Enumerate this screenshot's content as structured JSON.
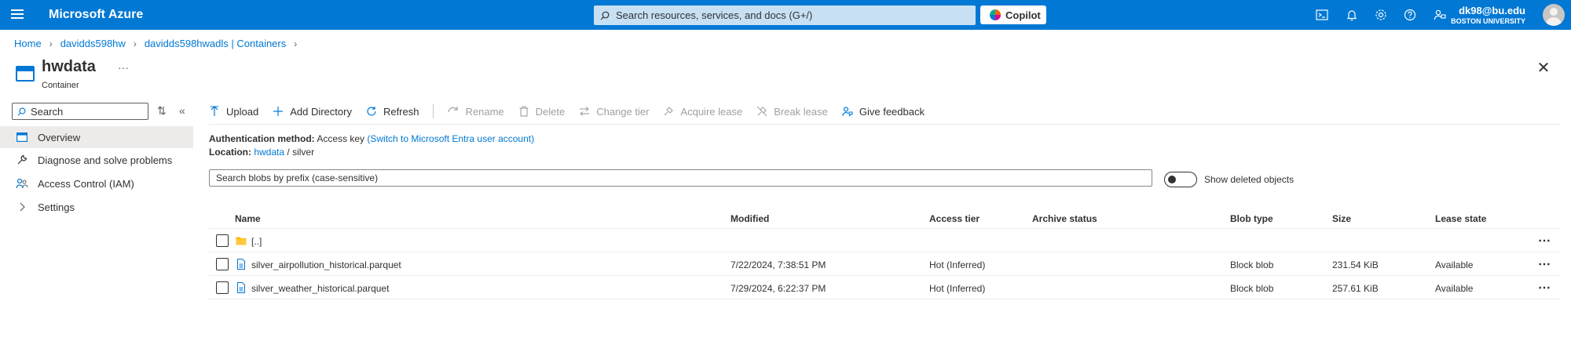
{
  "topbar": {
    "brand": "Microsoft Azure",
    "search_placeholder": "Search resources, services, and docs (G+/)",
    "copilot_label": "Copilot",
    "user_email": "dk98@bu.edu",
    "user_org": "BOSTON UNIVERSITY",
    "icons": [
      "cloud-shell-icon",
      "notifications-icon",
      "settings-icon",
      "help-icon",
      "feedback-icon"
    ]
  },
  "breadcrumb": [
    "Home",
    "davidds598hw",
    "davidds598hwadls | Containers"
  ],
  "header": {
    "title": "hwdata",
    "subtitle": "Container",
    "more": "···"
  },
  "nav": {
    "search_placeholder": "Search",
    "items": [
      {
        "label": "Overview",
        "icon": "overview-icon"
      },
      {
        "label": "Diagnose and solve problems",
        "icon": "wrench-icon"
      },
      {
        "label": "Access Control (IAM)",
        "icon": "people-icon"
      },
      {
        "label": "Settings",
        "icon": "chevron-right-icon"
      }
    ]
  },
  "toolbar": {
    "upload": "Upload",
    "add_directory": "Add Directory",
    "refresh": "Refresh",
    "rename": "Rename",
    "delete": "Delete",
    "change_tier": "Change tier",
    "acquire_lease": "Acquire lease",
    "break_lease": "Break lease",
    "give_feedback": "Give feedback"
  },
  "auth": {
    "label": "Authentication method:",
    "value": "Access key",
    "switch_link": "(Switch to Microsoft Entra user account)"
  },
  "location": {
    "label": "Location:",
    "container": "hwdata",
    "sep": "/",
    "folder": "silver"
  },
  "filter": {
    "placeholder": "Search blobs by prefix (case-sensitive)",
    "show_deleted_label": "Show deleted objects"
  },
  "table": {
    "columns": [
      "Name",
      "Modified",
      "Access tier",
      "Archive status",
      "Blob type",
      "Size",
      "Lease state"
    ],
    "rows": [
      {
        "name": "[..]",
        "type": "folder",
        "modified": "",
        "access_tier": "",
        "archive_status": "",
        "blob_type": "",
        "size": "",
        "lease_state": ""
      },
      {
        "name": "silver_airpollution_historical.parquet",
        "type": "file",
        "modified": "7/22/2024, 7:38:51 PM",
        "access_tier": "Hot (Inferred)",
        "archive_status": "",
        "blob_type": "Block blob",
        "size": "231.54 KiB",
        "lease_state": "Available"
      },
      {
        "name": "silver_weather_historical.parquet",
        "type": "file",
        "modified": "7/29/2024, 6:22:37 PM",
        "access_tier": "Hot (Inferred)",
        "archive_status": "",
        "blob_type": "Block blob",
        "size": "257.61 KiB",
        "lease_state": "Available"
      }
    ]
  },
  "colors": {
    "topbar": "#0078d4",
    "link": "#0078d4",
    "nav_active": "#edebe9",
    "folder": "#ffb900"
  }
}
